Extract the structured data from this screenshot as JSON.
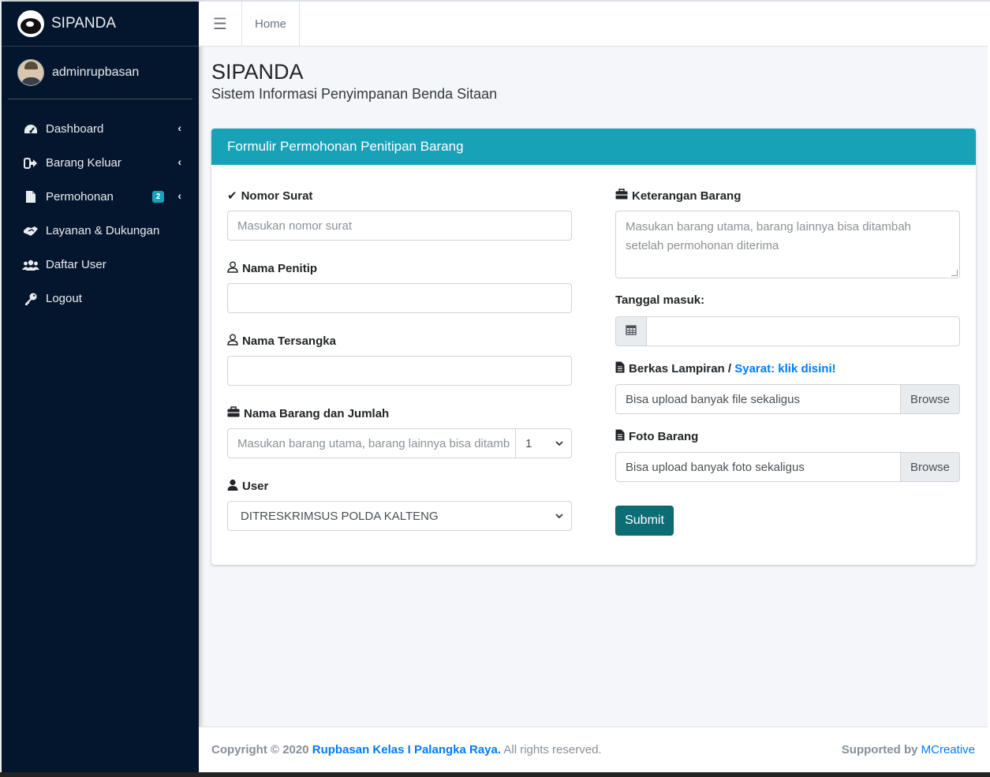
{
  "brand": {
    "name": "SIPANDA"
  },
  "user": {
    "name": "adminrupbasan"
  },
  "sidebar": {
    "items": [
      {
        "label": "Dashboard",
        "icon": "tachometer-icon",
        "has_arrow": true
      },
      {
        "label": "Barang Keluar",
        "icon": "sign-out-icon",
        "has_arrow": true
      },
      {
        "label": "Permohonan",
        "icon": "file-icon",
        "has_arrow": true,
        "badge": "2"
      },
      {
        "label": "Layanan & Dukungan",
        "icon": "handshake-icon",
        "has_arrow": false
      },
      {
        "label": "Daftar User",
        "icon": "users-icon",
        "has_arrow": false
      },
      {
        "label": "Logout",
        "icon": "key-icon",
        "has_arrow": false
      }
    ]
  },
  "navbar": {
    "home_label": "Home"
  },
  "page": {
    "title": "SIPANDA",
    "subtitle": "Sistem Informasi Penyimpanan Benda Sitaan"
  },
  "form": {
    "title": "Formulir Permohonan Penitipan Barang",
    "nomor_surat": {
      "label": "Nomor Surat",
      "placeholder": "Masukan nomor surat"
    },
    "nama_penitip": {
      "label": "Nama Penitip",
      "value": ""
    },
    "nama_tersangka": {
      "label": "Nama Tersangka",
      "value": ""
    },
    "nama_barang": {
      "label": "Nama Barang dan Jumlah",
      "placeholder": "Masukan barang utama, barang lainnya bisa ditamb",
      "qty": "1"
    },
    "user": {
      "label": "User",
      "value": "DITRESKRIMSUS POLDA KALTENG"
    },
    "keterangan": {
      "label": "Keterangan Barang",
      "placeholder_line1": "Masukan barang utama, barang lainnya bisa ditambah",
      "placeholder_line2": "setelah permohonan diterima"
    },
    "tanggal": {
      "label": "Tanggal masuk:",
      "value": ""
    },
    "berkas": {
      "label": "Berkas Lampiran / ",
      "link": "Syarat: klik disini!",
      "placeholder": "Bisa upload banyak file sekaligus",
      "browse": "Browse"
    },
    "foto": {
      "label": "Foto Barang",
      "placeholder": "Bisa upload banyak foto sekaligus",
      "browse": "Browse"
    },
    "submit": "Submit"
  },
  "footer": {
    "copyright_prefix": "Copyright © 2020 ",
    "org": "Rupbasan Kelas I Palangka Raya.",
    "rights": " All rights reserved.",
    "supported_prefix": "Supported by ",
    "supporter": "MCreative"
  },
  "colors": {
    "sidebar_bg": "#04162e",
    "card_header": "#17a2b8",
    "submit": "#0c6e74",
    "link": "#007bff"
  }
}
